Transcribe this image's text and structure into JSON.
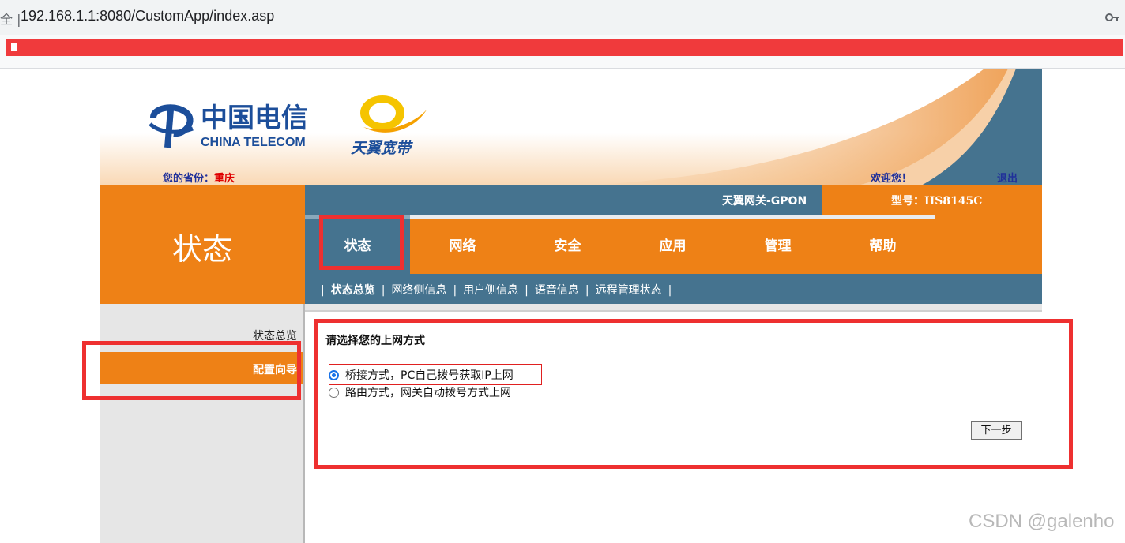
{
  "browser": {
    "left_glyph": "全 |",
    "url": "192.168.1.1:8080/CustomApp/index.asp"
  },
  "header": {
    "province_label": "您的省份：",
    "province_value": "重庆",
    "welcome": "欢迎您！",
    "logout": "退出",
    "brand_tianyi": "天翼宽带"
  },
  "section": {
    "title": "状态"
  },
  "gateway": {
    "name": "天翼网关-GPON",
    "model": "型号：HS8145C"
  },
  "nav": {
    "tabs": [
      "状态",
      "网络",
      "安全",
      "应用",
      "管理",
      "帮助"
    ],
    "active": "状态"
  },
  "subnav": {
    "items": [
      "状态总览",
      "网络侧信息",
      "用户侧信息",
      "语音信息",
      "远程管理状态"
    ],
    "active": "状态总览"
  },
  "left_menu": {
    "items": [
      "状态总览",
      "配置向导"
    ],
    "active": "配置向导"
  },
  "content": {
    "heading": "请选择您的上网方式",
    "options": [
      {
        "label": "桥接方式，PC自己拨号获取IP上网",
        "checked": true
      },
      {
        "label": "路由方式，网关自动拨号方式上网",
        "checked": false
      }
    ],
    "next_button": "下一步"
  },
  "watermark": "CSDN @galenho",
  "colors": {
    "orange": "#ee8116",
    "steel_blue": "#45738f",
    "annotation_red": "#ee3030"
  }
}
